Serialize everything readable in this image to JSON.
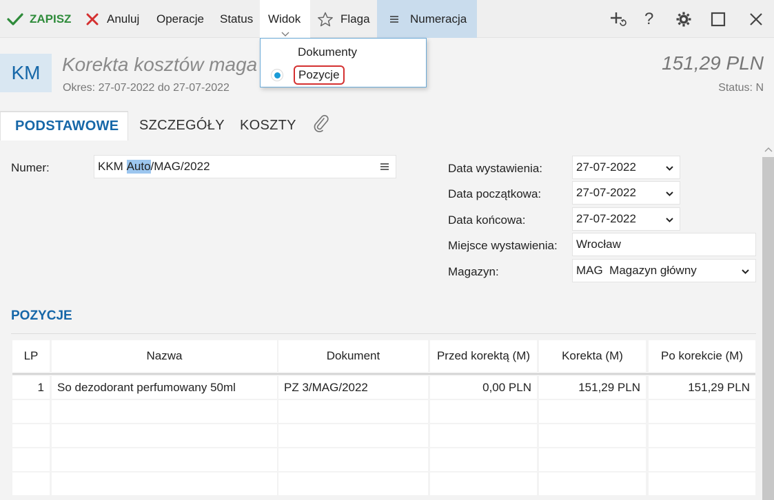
{
  "toolbar": {
    "save": "ZAPISZ",
    "cancel": "Anuluj",
    "operations": "Operacje",
    "status": "Status",
    "view": "Widok",
    "flag": "Flaga",
    "numbering": "Numeracja",
    "colors": {
      "save": "#2e8b3a",
      "cancel": "#d43030",
      "numbering_bg": "#c9dced"
    }
  },
  "view_menu": {
    "items": [
      {
        "label": "Dokumenty",
        "selected": false
      },
      {
        "label": "Pozycje",
        "selected": true
      }
    ]
  },
  "header": {
    "badge": "KM",
    "title": "Korekta kosztów maga",
    "period": "Okres: 27-07-2022 do 27-07-2022",
    "amount": "151,29 PLN",
    "status": "Status: N"
  },
  "tabs": [
    {
      "label": "PODSTAWOWE",
      "active": true
    },
    {
      "label": "SZCZEGÓŁY",
      "active": false
    },
    {
      "label": "KOSZTY",
      "active": false
    }
  ],
  "form": {
    "number_label": "Numer:",
    "number_prefix": "KKM ",
    "number_highlight": "Auto",
    "number_suffix": "/MAG/2022",
    "issue_date_label": "Data wystawienia:",
    "issue_date": "27-07-2022",
    "start_date_label": "Data początkowa:",
    "start_date": "27-07-2022",
    "end_date_label": "Data końcowa:",
    "end_date": "27-07-2022",
    "place_label": "Miejsce wystawienia:",
    "place": "Wrocław",
    "warehouse_label": "Magazyn:",
    "warehouse": "MAG  Magazyn główny"
  },
  "positions": {
    "title": "POZYCJE",
    "columns": [
      "LP",
      "Nazwa",
      "Dokument",
      "Przed korektą (M)",
      "Korekta (M)",
      "Po korekcie (M)"
    ],
    "rows": [
      {
        "lp": "1",
        "name": "So dezodorant perfumowany 50ml",
        "document": "PZ 3/MAG/2022",
        "before": "0,00 PLN",
        "correction": "151,29 PLN",
        "after": "151,29 PLN"
      }
    ]
  }
}
